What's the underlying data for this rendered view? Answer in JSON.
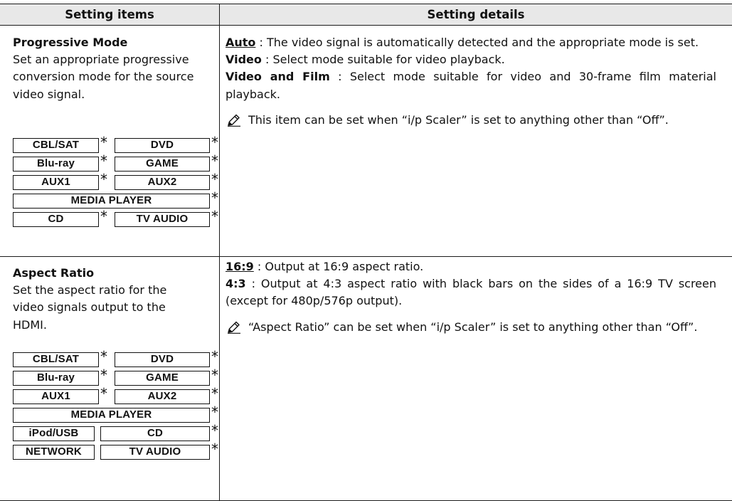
{
  "header": {
    "col_items": "Setting items",
    "col_details": "Setting details"
  },
  "rows": [
    {
      "title": "Progressive Mode",
      "description": "Set an appropriate progressive conversion mode for the source video signal.",
      "options": [
        {
          "key": "Auto",
          "text": " : The video signal is automatically detected and the appropriate mode is set."
        },
        {
          "key": "Video",
          "text": " : Select mode suitable for video playback."
        },
        {
          "key": "Video and Film",
          "text": " : Select mode suitable for video and 30-frame film material playback."
        }
      ],
      "note": "This item can be set when “i/p Scaler” is set to anything other than “Off”.",
      "sources": [
        "CBL/SAT",
        "DVD",
        "Blu-ray",
        "GAME",
        "AUX1",
        "AUX2",
        "MEDIA PLAYER",
        "CD",
        "TV AUDIO"
      ]
    },
    {
      "title": "Aspect Ratio",
      "description": "Set the aspect ratio for the video signals output to the HDMI.",
      "options": [
        {
          "key": "16:9",
          "text": " : Output at 16:9 aspect ratio."
        },
        {
          "key": "4:3",
          "text": " : Output at 4:3 aspect ratio with black bars on the sides of a 16:9 TV screen (except for 480p/576p output)."
        }
      ],
      "note": "“Aspect Ratio” can be set when “i/p Scaler” is set to anything other than “Off”.",
      "sources": [
        "CBL/SAT",
        "DVD",
        "Blu-ray",
        "GAME",
        "AUX1",
        "AUX2",
        "MEDIA PLAYER",
        "iPod/USB",
        "CD",
        "NETWORK",
        "TV AUDIO"
      ]
    }
  ],
  "star_symbol": "*",
  "icons": {
    "note": "pencil-note-icon"
  }
}
